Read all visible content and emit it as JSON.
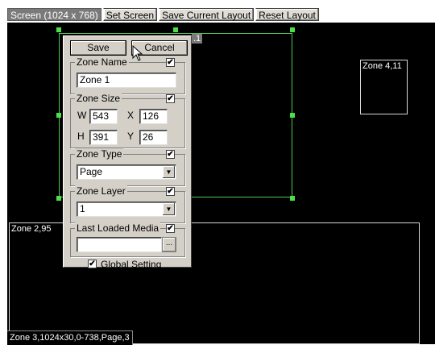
{
  "toolbar": {
    "screen_label": "Screen (1024 x 768)",
    "set_screen": "Set Screen",
    "save_layout": "Save Current Layout",
    "reset_layout": "Reset Layout"
  },
  "zones": {
    "zone1_label": ".1",
    "zone2_label": "Zone 2,95",
    "zone4_label": "Zone 4,11"
  },
  "status_bar": "Zone 3,1024x30,0-738,Page,3",
  "dialog": {
    "save": "Save",
    "cancel": "Cancel",
    "zone_name": {
      "title": "Zone Name",
      "checked": true,
      "value": "Zone 1"
    },
    "zone_size": {
      "title": "Zone Size",
      "checked": true,
      "w_label": "W",
      "w": "543",
      "x_label": "X",
      "x": "126",
      "h_label": "H",
      "h": "391",
      "y_label": "Y",
      "y": "26"
    },
    "zone_type": {
      "title": "Zone Type",
      "checked": true,
      "value": "Page"
    },
    "zone_layer": {
      "title": "Zone Layer",
      "checked": true,
      "value": "1"
    },
    "last_media": {
      "title": "Last Loaded Media",
      "checked": true,
      "value": "",
      "browse": "..."
    },
    "global_setting": {
      "label": "Global Setting",
      "checked": true
    }
  },
  "icons": {
    "check": "✔",
    "dropdown": "▼",
    "cursor": "arrow-pointer-icon"
  }
}
